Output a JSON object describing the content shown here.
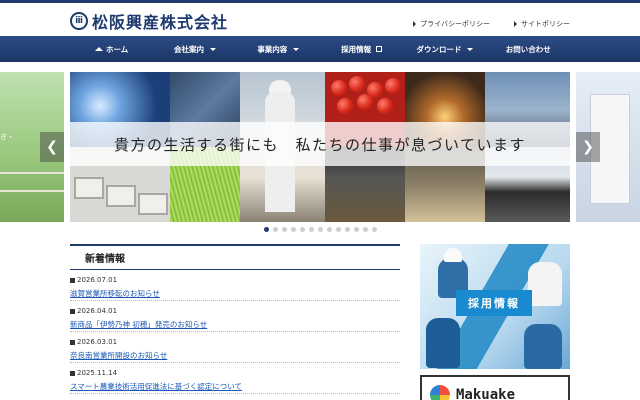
{
  "header": {
    "logo_mark": "ⅲ",
    "company_name": "松阪興産株式会社",
    "top_links": [
      "プライバシーポリシー",
      "サイトポリシー"
    ]
  },
  "nav": {
    "items": [
      {
        "label": "ホーム",
        "icon": "home-icon"
      },
      {
        "label": "会社案内",
        "dropdown": true
      },
      {
        "label": "事業内容",
        "dropdown": true
      },
      {
        "label": "採用情報",
        "icon": "external-link-icon"
      },
      {
        "label": "ダウンロード",
        "dropdown": true
      },
      {
        "label": "お問い合わせ"
      }
    ]
  },
  "slider": {
    "tagline": "貴方の生活する街にも　私たちの仕事が息づいています",
    "left_caption": "き・",
    "prev_icon": "chevron-left-icon",
    "next_icon": "chevron-right-icon",
    "dot_count": 13,
    "active_dot": 0
  },
  "news": {
    "title": "新着情報",
    "items": [
      {
        "date": "2026.07.01",
        "text": "滋賀営業所移転のお知らせ"
      },
      {
        "date": "2026.04.01",
        "text": "新商品「伊勢乃神 初穂」発売のお知らせ"
      },
      {
        "date": "2026.03.01",
        "text": "奈良南営業所開設のお知らせ"
      },
      {
        "date": "2025.11.14",
        "text": "スマート農業技術活用促進法に基づく認定について"
      }
    ]
  },
  "banners": {
    "recruit_label": "採用情報",
    "makuake_text": "Makuake"
  },
  "colors": {
    "primary": "#1e3a6e",
    "link": "#1a58b8",
    "recruit": "#1a8ad0"
  }
}
